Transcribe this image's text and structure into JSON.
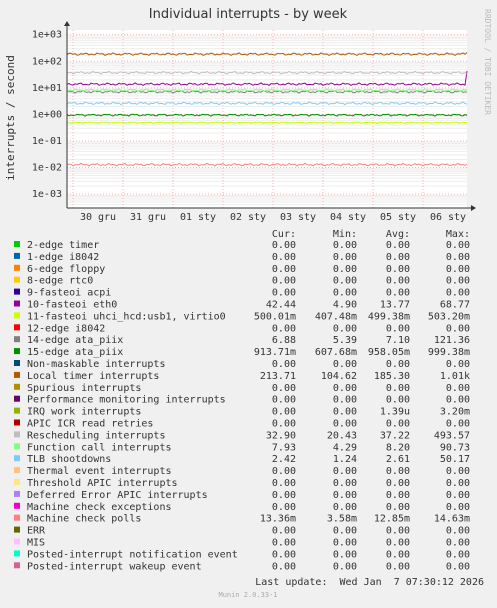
{
  "title": "Individual interrupts - by week",
  "ylabel": "interrupts / second",
  "watermark": "RRDTOOL / TOBI OETIKER",
  "footer": "Munin 2.0.33-1",
  "last_update": "Last update:  Wed Jan  7 07:30:12 2026",
  "legend_headers": [
    "Cur:",
    "Min:",
    "Avg:",
    "Max:"
  ],
  "chart_data": {
    "type": "line",
    "yscale": "log",
    "ylim": [
      0.0003,
      1500
    ],
    "yticks": [
      "1e+03",
      "1e+02",
      "1e+01",
      "1e+00",
      "1e-01",
      "1e-02",
      "1e-03"
    ],
    "ytick_values": [
      1000,
      100,
      10,
      1,
      0.1,
      0.01,
      0.001
    ],
    "xticks": [
      "30 gru",
      "31 gru",
      "01 sty",
      "02 sty",
      "03 sty",
      "04 sty",
      "05 sty",
      "06 sty"
    ],
    "grid": true,
    "series": [
      {
        "name": "2-edge      timer",
        "color": "#00cc00",
        "cur": "0.00",
        "min": "0.00",
        "avg": "0.00",
        "max": "0.00"
      },
      {
        "name": "1-edge      i8042",
        "color": "#0066b3",
        "cur": "0.00",
        "min": "0.00",
        "avg": "0.00",
        "max": "0.00"
      },
      {
        "name": "6-edge      floppy",
        "color": "#ff8000",
        "cur": "0.00",
        "min": "0.00",
        "avg": "0.00",
        "max": "0.00"
      },
      {
        "name": "8-edge      rtc0",
        "color": "#ffcc00",
        "cur": "0.00",
        "min": "0.00",
        "avg": "0.00",
        "max": "0.00"
      },
      {
        "name": "9-fasteoi   acpi",
        "color": "#330099",
        "cur": "0.00",
        "min": "0.00",
        "avg": "0.00",
        "max": "0.00"
      },
      {
        "name": "10-fasteoi   eth0",
        "color": "#990099",
        "cur": "42.44",
        "min": "4.90",
        "avg": "13.77",
        "max": "68.77"
      },
      {
        "name": "11-fasteoi   uhci_hcd:usb1, virtio0",
        "color": "#ccff00",
        "cur": "500.01m",
        "min": "407.48m",
        "avg": "499.38m",
        "max": "503.20m"
      },
      {
        "name": "12-edge      i8042",
        "color": "#ff0000",
        "cur": "0.00",
        "min": "0.00",
        "avg": "0.00",
        "max": "0.00"
      },
      {
        "name": "14-edge      ata_piix",
        "color": "#808080",
        "cur": "6.88",
        "min": "5.39",
        "avg": "7.10",
        "max": "121.36"
      },
      {
        "name": "15-edge      ata_piix",
        "color": "#008f00",
        "cur": "913.71m",
        "min": "607.68m",
        "avg": "958.05m",
        "max": "999.38m"
      },
      {
        "name": "Non-maskable interrupts",
        "color": "#00487d",
        "cur": "0.00",
        "min": "0.00",
        "avg": "0.00",
        "max": "0.00"
      },
      {
        "name": "Local timer interrupts",
        "color": "#b35a00",
        "cur": "213.71",
        "min": "104.62",
        "avg": "185.30",
        "max": "1.01k"
      },
      {
        "name": "Spurious interrupts",
        "color": "#b38f00",
        "cur": "0.00",
        "min": "0.00",
        "avg": "0.00",
        "max": "0.00"
      },
      {
        "name": "Performance monitoring interrupts",
        "color": "#6b006b",
        "cur": "0.00",
        "min": "0.00",
        "avg": "0.00",
        "max": "0.00"
      },
      {
        "name": "IRQ work interrupts",
        "color": "#8fb300",
        "cur": "0.00",
        "min": "0.00",
        "avg": "1.39u",
        "max": "3.20m"
      },
      {
        "name": "APIC ICR read retries",
        "color": "#b30000",
        "cur": "0.00",
        "min": "0.00",
        "avg": "0.00",
        "max": "0.00"
      },
      {
        "name": "Rescheduling interrupts",
        "color": "#bebebe",
        "cur": "32.90",
        "min": "20.43",
        "avg": "37.22",
        "max": "493.57"
      },
      {
        "name": "Function call interrupts",
        "color": "#80ff80",
        "cur": "7.93",
        "min": "4.29",
        "avg": "8.20",
        "max": "90.73"
      },
      {
        "name": "TLB shootdowns",
        "color": "#80c9ff",
        "cur": "2.42",
        "min": "1.24",
        "avg": "2.61",
        "max": "50.17"
      },
      {
        "name": "Thermal event interrupts",
        "color": "#ffc080",
        "cur": "0.00",
        "min": "0.00",
        "avg": "0.00",
        "max": "0.00"
      },
      {
        "name": "Threshold APIC interrupts",
        "color": "#ffe680",
        "cur": "0.00",
        "min": "0.00",
        "avg": "0.00",
        "max": "0.00"
      },
      {
        "name": "Deferred Error APIC interrupts",
        "color": "#aa80ff",
        "cur": "0.00",
        "min": "0.00",
        "avg": "0.00",
        "max": "0.00"
      },
      {
        "name": "Machine check exceptions",
        "color": "#ee00cc",
        "cur": "0.00",
        "min": "0.00",
        "avg": "0.00",
        "max": "0.00"
      },
      {
        "name": "Machine check polls",
        "color": "#ff8080",
        "cur": "13.36m",
        "min": "3.58m",
        "avg": "12.85m",
        "max": "14.63m"
      },
      {
        "name": "ERR",
        "color": "#666600",
        "cur": "0.00",
        "min": "0.00",
        "avg": "0.00",
        "max": "0.00"
      },
      {
        "name": "MIS",
        "color": "#ffbfff",
        "cur": "0.00",
        "min": "0.00",
        "avg": "0.00",
        "max": "0.00"
      },
      {
        "name": "Posted-interrupt notification event",
        "color": "#00ffcc",
        "cur": "0.00",
        "min": "0.00",
        "avg": "0.00",
        "max": "0.00"
      },
      {
        "name": "Posted-interrupt wakeup event",
        "color": "#cc6699",
        "cur": "0.00",
        "min": "0.00",
        "avg": "0.00",
        "max": "0.00"
      }
    ]
  }
}
